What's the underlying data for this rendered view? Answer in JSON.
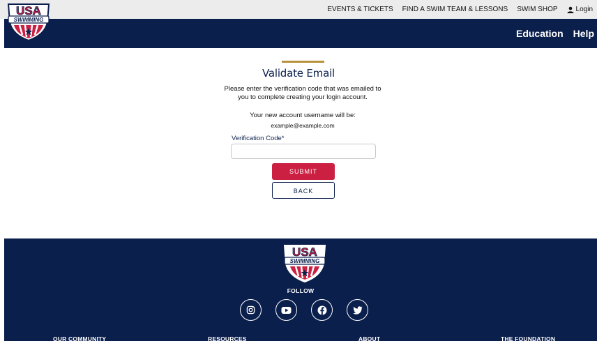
{
  "brand": {
    "logo_text_top": "USA",
    "logo_text_bottom": "SWIMMING",
    "colors": {
      "navy": "#0b1f4c",
      "red": "#cc2043",
      "gold": "#b8913c",
      "topbar": "#ececec"
    }
  },
  "topnav": {
    "items": [
      "EVENTS & TICKETS",
      "FIND A SWIM TEAM & LESSONS",
      "SWIM SHOP"
    ],
    "login_label": "Login",
    "login_icon": "user-icon"
  },
  "mainnav": {
    "items": [
      "Education",
      "Help"
    ]
  },
  "form": {
    "title": "Validate Email",
    "description": "Please enter the verification code that was emailed to you to complete creating your login account.",
    "username_label": "Your new account username will be:",
    "username_value": "example@example.com",
    "field_label": "Verification Code*",
    "field_value": "",
    "submit_label": "SUBMIT",
    "back_label": "BACK"
  },
  "footer": {
    "follow_label": "FOLLOW",
    "socials": [
      "instagram-icon",
      "youtube-icon",
      "facebook-icon",
      "twitter-icon"
    ],
    "columns": [
      "OUR COMMUNITY",
      "RESOURCES",
      "ABOUT",
      "THE FOUNDATION"
    ]
  }
}
